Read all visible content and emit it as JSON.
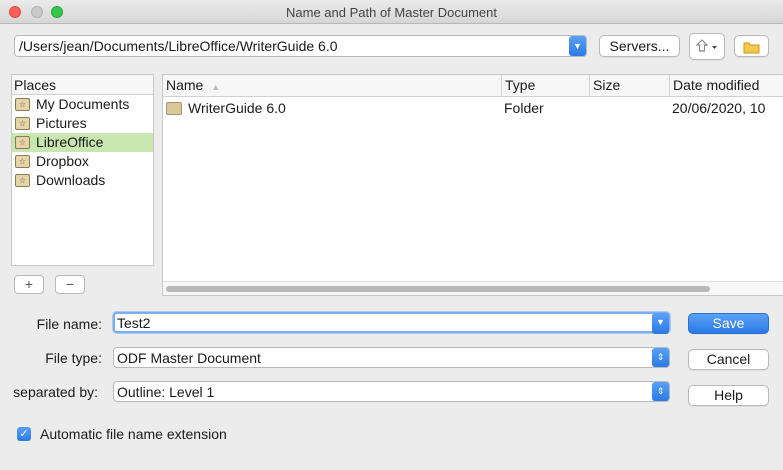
{
  "window": {
    "title": "Name and Path of Master Document"
  },
  "toolbar": {
    "path": "/Users/jean/Documents/LibreOffice/WriterGuide 6.0",
    "servers_label": "Servers...",
    "up_icon": "up-arrow-icon",
    "newfolder_icon": "new-folder-icon"
  },
  "places": {
    "header": "Places",
    "items": [
      {
        "label": "My Documents",
        "selected": false
      },
      {
        "label": "Pictures",
        "selected": false
      },
      {
        "label": "LibreOffice",
        "selected": true
      },
      {
        "label": "Dropbox",
        "selected": false
      },
      {
        "label": "Downloads",
        "selected": false
      }
    ],
    "add_label": "+",
    "remove_label": "−"
  },
  "filelist": {
    "columns": [
      "Name",
      "Type",
      "Size",
      "Date modified"
    ],
    "rows": [
      {
        "name": "WriterGuide 6.0",
        "type": "Folder",
        "size": "",
        "date": "20/06/2020, 10"
      }
    ]
  },
  "form": {
    "filename_label": "File name:",
    "filename_value": "Test2",
    "filetype_label": "File type:",
    "filetype_value": "ODF Master Document",
    "separated_label": "separated by:",
    "separated_value": "Outline: Level 1",
    "autoext_label": "Automatic file name extension",
    "autoext_checked": true
  },
  "buttons": {
    "save": "Save",
    "cancel": "Cancel",
    "help": "Help"
  },
  "colors": {
    "accent": "#2a79e6",
    "selection": "#c8e6b0"
  }
}
